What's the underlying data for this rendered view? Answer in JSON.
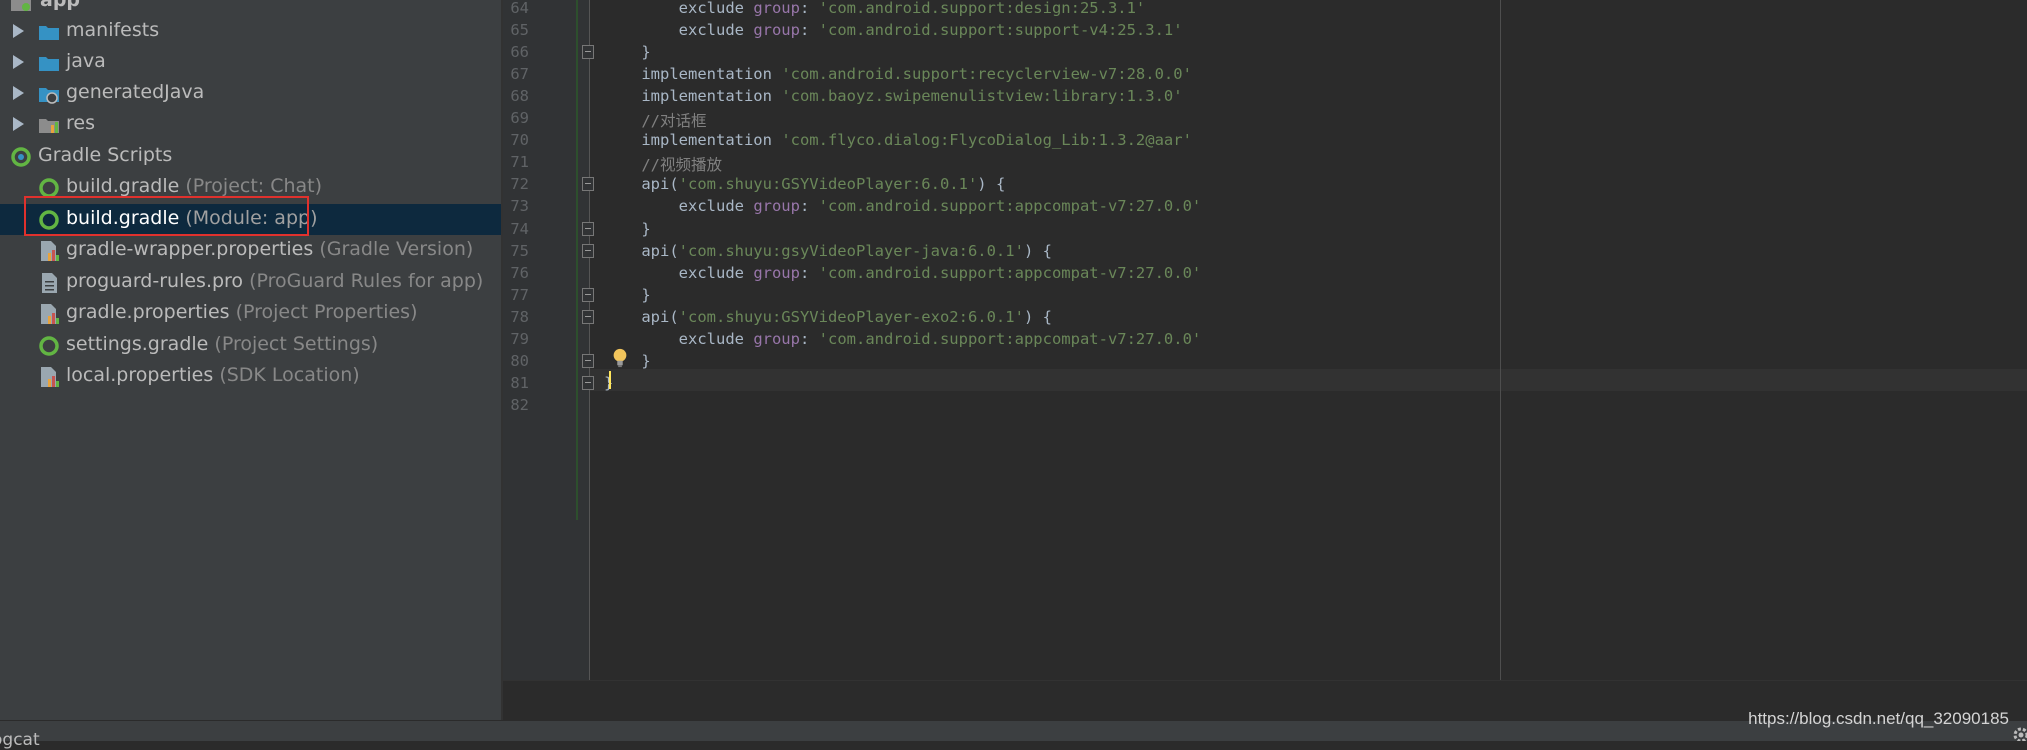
{
  "project_tree": {
    "app": "app",
    "items": [
      {
        "label": "manifests",
        "hint": ""
      },
      {
        "label": "java",
        "hint": ""
      },
      {
        "label": "generatedJava",
        "hint": ""
      },
      {
        "label": "res",
        "hint": ""
      },
      {
        "label": "Gradle Scripts",
        "hint": ""
      },
      {
        "label": "build.gradle",
        "hint": "(Project: Chat)"
      },
      {
        "label": "build.gradle",
        "hint": "(Module: app)"
      },
      {
        "label": "gradle-wrapper.properties",
        "hint": "(Gradle Version)"
      },
      {
        "label": "proguard-rules.pro",
        "hint": "(ProGuard Rules for app)"
      },
      {
        "label": "gradle.properties",
        "hint": "(Project Properties)"
      },
      {
        "label": "settings.gradle",
        "hint": "(Project Settings)"
      },
      {
        "label": "local.properties",
        "hint": "(SDK Location)"
      }
    ],
    "selected_index": 6
  },
  "editor": {
    "lines": [
      {
        "num": "64",
        "parts": [
          {
            "t": "        exclude ",
            "c": "kw"
          },
          {
            "t": "group",
            "c": "named"
          },
          {
            "t": ": ",
            "c": "kw"
          },
          {
            "t": "'com.android.support:design:25.3.1'",
            "c": "str"
          }
        ]
      },
      {
        "num": "65",
        "parts": [
          {
            "t": "        exclude ",
            "c": "kw"
          },
          {
            "t": "group",
            "c": "named"
          },
          {
            "t": ": ",
            "c": "kw"
          },
          {
            "t": "'com.android.support:support-v4:25.3.1'",
            "c": "str"
          }
        ]
      },
      {
        "num": "66",
        "parts": [
          {
            "t": "    }",
            "c": "kw"
          }
        ]
      },
      {
        "num": "67",
        "parts": [
          {
            "t": "    implementation ",
            "c": "kw"
          },
          {
            "t": "'com.android.support:recyclerview-v7:28.0.0'",
            "c": "str"
          }
        ]
      },
      {
        "num": "68",
        "parts": [
          {
            "t": "    implementation ",
            "c": "kw"
          },
          {
            "t": "'com.baoyz.swipemenulistview:library:1.3.0'",
            "c": "str"
          }
        ]
      },
      {
        "num": "69",
        "parts": [
          {
            "t": "    //对话框",
            "c": "cmt"
          }
        ]
      },
      {
        "num": "70",
        "parts": [
          {
            "t": "    implementation ",
            "c": "kw"
          },
          {
            "t": "'com.flyco.dialog:FlycoDialog_Lib:1.3.2@aar'",
            "c": "str"
          }
        ]
      },
      {
        "num": "71",
        "parts": [
          {
            "t": "    //视频播放",
            "c": "cmt"
          }
        ]
      },
      {
        "num": "72",
        "parts": [
          {
            "t": "    api(",
            "c": "kw"
          },
          {
            "t": "'com.shuyu:GSYVideoPlayer:6.0.1'",
            "c": "str"
          },
          {
            "t": ") {",
            "c": "kw"
          }
        ]
      },
      {
        "num": "73",
        "parts": [
          {
            "t": "        exclude ",
            "c": "kw"
          },
          {
            "t": "group",
            "c": "named"
          },
          {
            "t": ": ",
            "c": "kw"
          },
          {
            "t": "'com.android.support:appcompat-v7:27.0.0'",
            "c": "str"
          }
        ]
      },
      {
        "num": "74",
        "parts": [
          {
            "t": "    }",
            "c": "kw"
          }
        ]
      },
      {
        "num": "75",
        "parts": [
          {
            "t": "    api(",
            "c": "kw"
          },
          {
            "t": "'com.shuyu:gsyVideoPlayer-java:6.0.1'",
            "c": "str"
          },
          {
            "t": ") {",
            "c": "kw"
          }
        ]
      },
      {
        "num": "76",
        "parts": [
          {
            "t": "        exclude ",
            "c": "kw"
          },
          {
            "t": "group",
            "c": "named"
          },
          {
            "t": ": ",
            "c": "kw"
          },
          {
            "t": "'com.android.support:appcompat-v7:27.0.0'",
            "c": "str"
          }
        ]
      },
      {
        "num": "77",
        "parts": [
          {
            "t": "    }",
            "c": "kw"
          }
        ]
      },
      {
        "num": "78",
        "parts": [
          {
            "t": "    api(",
            "c": "kw"
          },
          {
            "t": "'com.shuyu:GSYVideoPlayer-exo2:6.0.1'",
            "c": "str"
          },
          {
            "t": ") {",
            "c": "kw"
          }
        ]
      },
      {
        "num": "79",
        "parts": [
          {
            "t": "        exclude ",
            "c": "kw"
          },
          {
            "t": "group",
            "c": "named"
          },
          {
            "t": ": ",
            "c": "kw"
          },
          {
            "t": "'com.android.support:appcompat-v7:27.0.0'",
            "c": "str"
          }
        ]
      },
      {
        "num": "80",
        "parts": [
          {
            "t": "    }",
            "c": "kw"
          }
        ]
      },
      {
        "num": "81",
        "parts": [
          {
            "t": "}",
            "c": "kw"
          }
        ]
      },
      {
        "num": "82",
        "parts": []
      }
    ]
  },
  "bottom": {
    "logcat": "ogcat",
    "watermark": "https://blog.csdn.net/qq_32090185"
  }
}
